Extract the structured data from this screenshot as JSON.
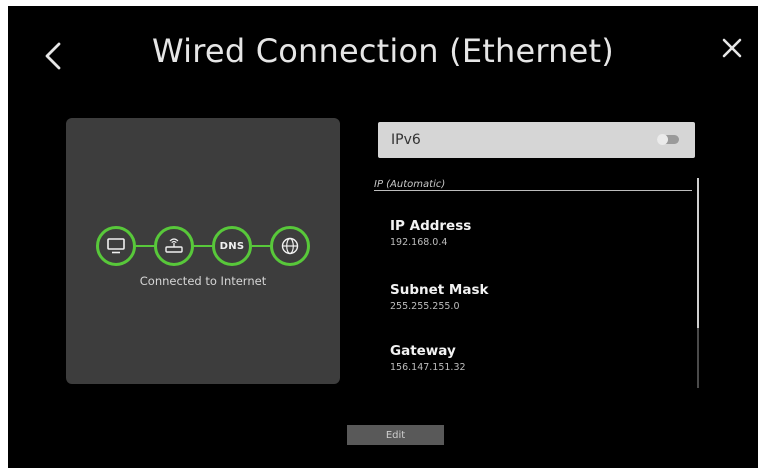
{
  "header": {
    "title": "Wired Connection (Ethernet)",
    "back_icon": "chevron-left-icon",
    "close_icon": "close-icon"
  },
  "status": {
    "nodes": [
      {
        "icon": "tv-icon"
      },
      {
        "icon": "router-icon"
      },
      {
        "icon": "dns-icon",
        "text": "DNS"
      },
      {
        "icon": "globe-icon"
      }
    ],
    "text": "Connected to Internet",
    "accent_color": "#58c83a"
  },
  "ipv6": {
    "label": "IPv6",
    "enabled": false
  },
  "section_label": "IP (Automatic)",
  "fields": [
    {
      "label": "IP Address",
      "value": "192.168.0.4"
    },
    {
      "label": "Subnet Mask",
      "value": "255.255.255.0"
    },
    {
      "label": "Gateway",
      "value": "156.147.151.32"
    }
  ],
  "edit_button": {
    "label": "Edit"
  }
}
